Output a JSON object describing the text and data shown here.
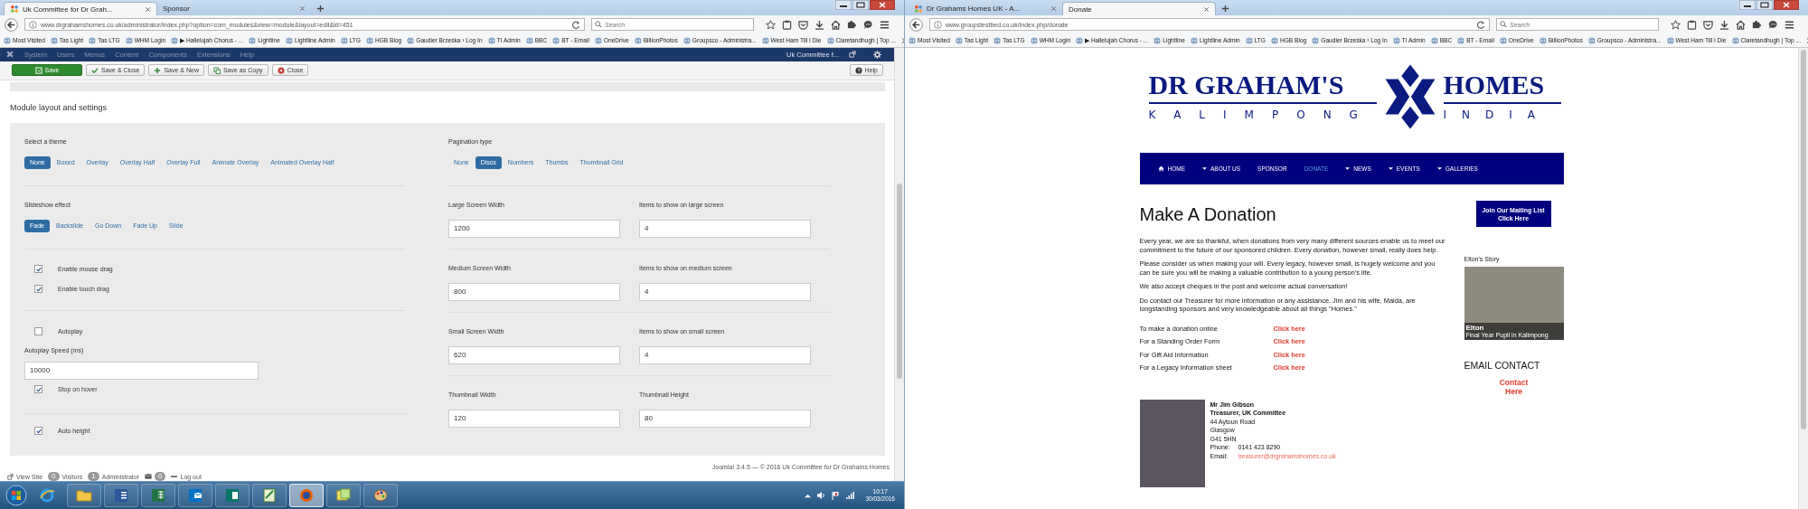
{
  "left_window": {
    "tabs": [
      {
        "title": "Uk Committee for Dr Grah...",
        "favicon": true,
        "selected": true
      },
      {
        "title": "Sponsor",
        "favicon": false,
        "selected": false
      }
    ],
    "address": "www.drgrahamshomes.co.uk/administrator/index.php?option=com_modules&view=module&layout=edit&id=451",
    "search": {
      "placeholder": "Search"
    },
    "bookmarks": [
      "Most Visited",
      "Tas Light",
      "Tas LTG",
      "WHM Login",
      "▶ Hallelujah Chorus - ...",
      "Lightline",
      "Lightline Admin",
      "LTG",
      "HGB Blog",
      "Gaudier Brzeska › Log In",
      "TI Admin",
      "BBC",
      "BT - Email",
      "OneDrive",
      "BillionPhotos",
      "Groupsco - Administra...",
      "West Ham Till I Die",
      "Claretandhugh | Top ..."
    ],
    "admin_menu": {
      "items": [
        "System",
        "Users",
        "Menus",
        "Content",
        "Components",
        "Extensions",
        "Help"
      ],
      "site_name": "Uk Committee f..."
    },
    "toolbar": [
      {
        "label": "Save",
        "kind": "save"
      },
      {
        "label": "Save & Close",
        "kind": "save-close"
      },
      {
        "label": "Save & New",
        "kind": "save-new"
      },
      {
        "label": "Save as Copy",
        "kind": "save-copy"
      },
      {
        "label": "Close",
        "kind": "close"
      },
      {
        "label": "Help",
        "kind": "help"
      }
    ],
    "section_title": "Module layout and settings",
    "settings": {
      "left": [
        {
          "fields": [
            {
              "kind": "toggle",
              "label": "Select a theme",
              "options": [
                {
                  "label": "None",
                  "selected": true
                },
                {
                  "label": "Boxed",
                  "selected": false
                },
                {
                  "label": "Overlay",
                  "selected": false
                },
                {
                  "label": "Overlay Half",
                  "selected": false
                },
                {
                  "label": "Overlay Full",
                  "selected": false
                },
                {
                  "label": "Animate Overlay",
                  "selected": false
                },
                {
                  "label": "Animated Overlay Half",
                  "selected": false
                }
              ]
            }
          ]
        },
        {
          "fields": [
            {
              "kind": "toggle",
              "label": "Slideshow effect",
              "options": [
                {
                  "label": "Fade",
                  "selected": true
                },
                {
                  "label": "Backslide",
                  "selected": false
                },
                {
                  "label": "Go Down",
                  "selected": false
                },
                {
                  "label": "Fade Up",
                  "selected": false
                },
                {
                  "label": "Slide",
                  "selected": false
                }
              ]
            }
          ]
        },
        {
          "fields": [
            {
              "kind": "checkbox",
              "label": "Enable mouse drag",
              "checked": true
            },
            {
              "kind": "checkbox",
              "label": "Enable touch drag",
              "checked": true
            }
          ]
        },
        {
          "fields": [
            {
              "kind": "checkbox",
              "label": "Autoplay",
              "checked": false
            },
            {
              "kind": "text",
              "label": "Autoplay Speed (ms)",
              "value": "10000"
            },
            {
              "kind": "checkbox",
              "label": "Stop on hover",
              "checked": true
            }
          ]
        },
        {
          "fields": [
            {
              "kind": "checkbox",
              "label": "Auto height",
              "checked": true
            }
          ]
        }
      ],
      "right": [
        {
          "fields": [
            {
              "kind": "toggle",
              "label": "Pagination type",
              "options": [
                {
                  "label": "None",
                  "selected": false
                },
                {
                  "label": "Discs",
                  "selected": true
                },
                {
                  "label": "Numbers",
                  "selected": false
                },
                {
                  "label": "Thumbs",
                  "selected": false
                },
                {
                  "label": "Thumbnail Grid",
                  "selected": false
                }
              ]
            }
          ]
        },
        {
          "fields": [
            {
              "kind": "pair",
              "items": [
                {
                  "label": "Large Screen Width",
                  "value": "1200"
                },
                {
                  "label": "Items to show on large screen",
                  "value": "4"
                }
              ]
            }
          ]
        },
        {
          "fields": [
            {
              "kind": "pair",
              "items": [
                {
                  "label": "Medium Screen Width",
                  "value": "800"
                },
                {
                  "label": "Items to show on medium screen",
                  "value": "4"
                }
              ]
            }
          ]
        },
        {
          "fields": [
            {
              "kind": "pair",
              "items": [
                {
                  "label": "Small Screen Width",
                  "value": "620"
                },
                {
                  "label": "Items to show on small screen",
                  "value": "4"
                }
              ]
            }
          ]
        },
        {
          "fields": [
            {
              "kind": "pair",
              "items": [
                {
                  "label": "Thumbnail Width",
                  "value": "120"
                },
                {
                  "label": "Thumbnail Height",
                  "value": "80"
                }
              ]
            }
          ]
        }
      ]
    },
    "footer": {
      "copyright": "Joomla! 3.4.5 — © 2016 Uk Committee for Dr Grahams Homes",
      "items": [
        {
          "kind": "view",
          "label": "View Site"
        },
        {
          "kind": "count",
          "count": "0",
          "label": "Visitors"
        },
        {
          "kind": "count",
          "count": "1",
          "label": "Administrator"
        },
        {
          "kind": "mail",
          "count": "0"
        },
        {
          "kind": "logout",
          "label": "Log out"
        }
      ]
    }
  },
  "taskbar": {
    "apps": [
      {
        "kind": "ie",
        "active": false
      },
      {
        "kind": "explorer",
        "active": false
      },
      {
        "kind": "word",
        "active": false
      },
      {
        "kind": "excel",
        "active": false
      },
      {
        "kind": "outlook",
        "active": false
      },
      {
        "kind": "publisher",
        "active": false
      },
      {
        "kind": "editor",
        "active": false
      },
      {
        "kind": "firefox",
        "active": true
      },
      {
        "kind": "notes",
        "active": false
      },
      {
        "kind": "paint",
        "active": false
      }
    ],
    "time": "10:17",
    "date": "30/03/2016"
  },
  "right_window": {
    "tabs": [
      {
        "title": "Dr Grahams Homes UK - A...",
        "favicon": true,
        "selected": false
      },
      {
        "title": "Donate",
        "favicon": false,
        "selected": true
      }
    ],
    "address": "www.groupstestbed.co.uk/index.php/donate",
    "search": {
      "placeholder": "Search"
    },
    "bookmarks": [
      "Most Visited",
      "Tas Light",
      "Tas LTG",
      "WHM Login",
      "▶ Hallelujah Chorus - ...",
      "Lightline",
      "Lightline Admin",
      "LTG",
      "HGB Blog",
      "Gaudier Brzeska › Log In",
      "TI Admin",
      "BBC",
      "BT - Email",
      "OneDrive",
      "BillionPhotos",
      "Groupsco - Administra...",
      "West Ham Till I Die",
      "Claretandhugh | Top ..."
    ],
    "page": {
      "logo": {
        "left_word": "DR GRAHAM'S",
        "right_word": "HOMES",
        "left_sub": "KALIMPONG",
        "right_sub": "INDIA"
      },
      "nav": [
        {
          "label": "HOME",
          "kind": "home",
          "dropdown": false,
          "selected": false
        },
        {
          "label": "ABOUT US",
          "kind": "link",
          "dropdown": true,
          "selected": false
        },
        {
          "label": "SPONSOR",
          "kind": "link",
          "dropdown": false,
          "selected": false
        },
        {
          "label": "DONATE",
          "kind": "link",
          "dropdown": false,
          "selected": true
        },
        {
          "label": "NEWS",
          "kind": "link",
          "dropdown": true,
          "selected": false
        },
        {
          "label": "EVENTS",
          "kind": "link",
          "dropdown": true,
          "selected": false
        },
        {
          "label": "GALLERIES",
          "kind": "link",
          "dropdown": true,
          "selected": false
        }
      ],
      "heading": "Make A Donation",
      "paragraphs": [
        "Every year, we are so thankful, when donations from very many different sources enable us to meet our commitment to the future of our sponsored children. Every donation, however small, really does help.",
        "Please consider us when making your will. Every legacy, however small, is hugely welcome and you can be sure you will be making a valuable contribution to a young person’s life.",
        "We also accept cheques in the post and welcome actual conversation!",
        "Do contact our Treasurer for more information or any assistance. Jim and his wife, Maida, are longstanding sponsors and very knowledgeable about all things \"Homes.\""
      ],
      "donation_links": [
        {
          "label": "To make a donation online",
          "link": "Click here"
        },
        {
          "label": "For a Standing Order Form",
          "link": "Click here"
        },
        {
          "label": "For Gift Aid Information",
          "link": "Click here"
        },
        {
          "label": "For a Legacy Information sheet",
          "link": "Click here"
        }
      ],
      "contact": {
        "name": "Mr Jim Gibson",
        "role": "Treasurer, UK Committee",
        "address": [
          "44 Aytoun Road",
          "Glasgow",
          "G41 5HN"
        ],
        "phone_label": "Phone:",
        "phone": "0141 423 8290",
        "email_label": "Email:",
        "email": "treasurer@drgrahamshomes.co.uk"
      },
      "sidebar": {
        "mailing_button": [
          "Join Our Mailing List",
          "Click Here"
        ],
        "story_title": "Elton's Story",
        "story_caption": {
          "name": "Elton",
          "subtitle": "Final Year Pupil in Kalimpong"
        },
        "email_heading": "EMAIL CONTACT",
        "contact_link": [
          "Contact",
          "Here"
        ]
      }
    }
  }
}
